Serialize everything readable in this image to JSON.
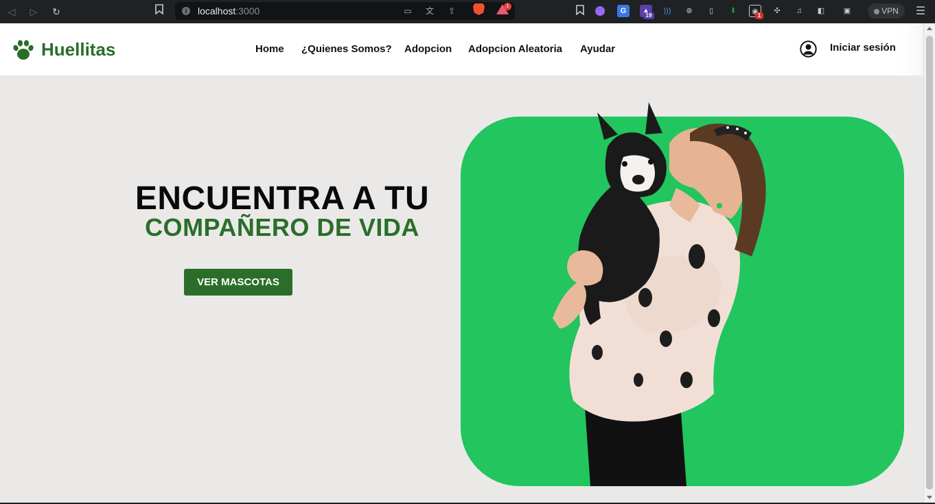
{
  "browser": {
    "url_host": "localhost",
    "url_port": ":3000",
    "brave_badge": "1",
    "ext_badge_1": "19",
    "ext_badge_2": "1",
    "vpn_label": "VPN"
  },
  "site": {
    "brand": "Huellitas",
    "nav": [
      "Home",
      "¿Quienes Somos?",
      "Adopcion",
      "Adopcion Aleatoria",
      "Ayudar"
    ],
    "login_label": "Iniciar sesión"
  },
  "hero": {
    "title": "ENCUENTRA A TU",
    "subtitle": "COMPAÑERO DE VIDA",
    "cta_label": "VER MASCOTAS"
  },
  "colors": {
    "brand_green": "#2a6e2a",
    "card_green": "#22c55e",
    "page_bg": "#ebe9e7"
  }
}
